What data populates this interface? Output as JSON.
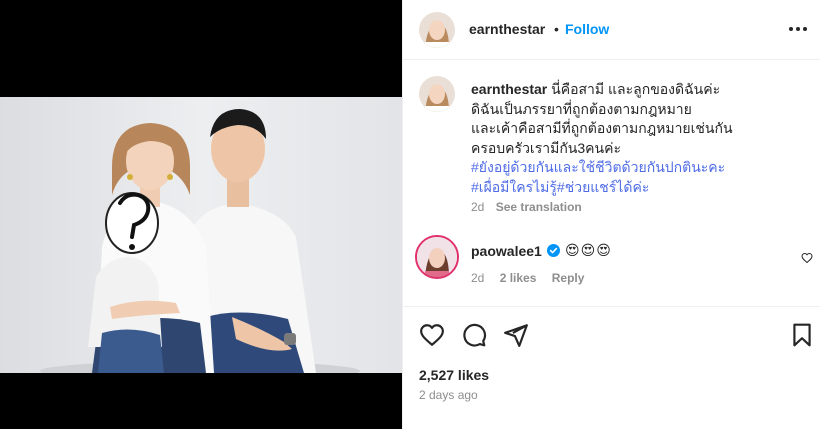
{
  "post": {
    "username": "earnthestar",
    "follow_label": "Follow",
    "separator": "•",
    "more_icon": "more-horizontal-icon"
  },
  "caption": {
    "username": "earnthestar",
    "line1": "นี่คือสามี และลูกของดิฉันค่ะ",
    "line2": "ดิฉันเป็นภรรยาที่ถูกต้องตามกฎหมาย",
    "line3": "และเค้าคือสามีที่ถูกต้องตามกฎหมายเช่นกัน",
    "line4": "ครอบครัวเรามีกัน3คนค่ะ",
    "hashtag1": "#ยังอยู่ด้วยกันและใช้ชีวิตด้วยกันปกตินะคะ",
    "hashtag2": "#เผื่อมีใครไม่รู้",
    "hashtag3": "#ช่วยแชร์ได้ค่ะ",
    "time": "2d",
    "translate": "See translation"
  },
  "comment": {
    "username": "paowalee1",
    "emojis": "😍😍😍",
    "time": "2d",
    "likes": "2 likes",
    "reply": "Reply"
  },
  "footer": {
    "likes": "2,527 likes",
    "time_ago": "2 days ago"
  },
  "colors": {
    "accent": "#0095f6",
    "hashtag": "#4f6ce6",
    "muted": "#8e8e8e",
    "story_ring": "#e1306c"
  }
}
